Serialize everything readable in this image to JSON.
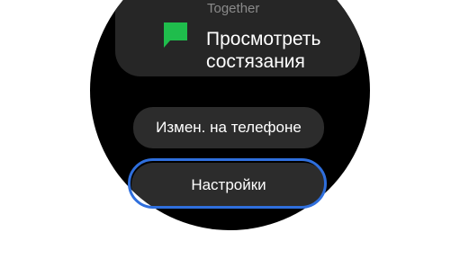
{
  "card": {
    "subtitle": "Together",
    "title": "Просмотреть состязания",
    "icon": "flag-icon",
    "icon_color": "#1fbd4c"
  },
  "buttons": {
    "phone_label": "Измен. на телефоне",
    "settings_label": "Настройки"
  },
  "colors": {
    "watch_background": "#000000",
    "button_background": "#2c2c2c",
    "focus_ring": "#2f6fdd",
    "text": "#ffffff",
    "subtitle_text": "#8a8a8a"
  }
}
